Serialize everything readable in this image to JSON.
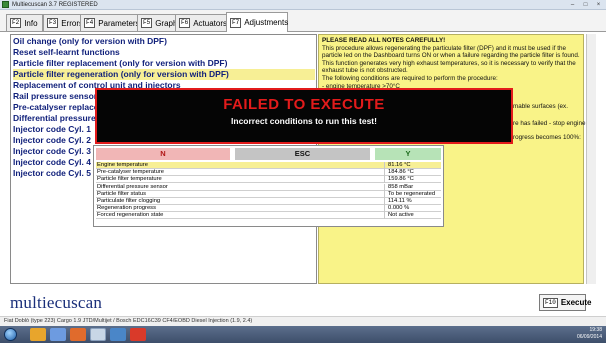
{
  "window": {
    "title": "Multiecuscan 3.7 REGISTERED",
    "buttons": [
      "–",
      "□",
      "×"
    ]
  },
  "tabs": [
    {
      "fkey": "F2",
      "label": "Info"
    },
    {
      "fkey": "F3",
      "label": "Errors"
    },
    {
      "fkey": "F4",
      "label": "Parameters"
    },
    {
      "fkey": "F5",
      "label": "Graph"
    },
    {
      "fkey": "F6",
      "label": "Actuators"
    },
    {
      "fkey": "F7",
      "label": "Adjustments"
    }
  ],
  "active_tab": "Adjustments",
  "procedures": [
    "Oil change (only for version with DPF)",
    "Reset self-learnt functions",
    "Particle filter replacement (only for version with DPF)",
    "Particle filter regeneration (only for version with DPF)",
    "Replacement of control unit and injectors",
    "Rail pressure sensor",
    "Pre-catalyser replace",
    "Differential pressure",
    "Injector code Cyl. 1",
    "Injector code Cyl. 2",
    "Injector code Cyl. 3",
    "Injector code Cyl. 4",
    "Injector code Cyl. 5"
  ],
  "selected_procedure": "Particle filter regeneration (only for version with DPF)",
  "notes": {
    "lines": [
      "PLEASE READ ALL NOTES CAREFULLY!",
      "This procedure allows regenerating the particulate filter (DPF) and it must be used if the",
      "particle led on the Dashboard turns ON or when a failure regarding the particle filter is found.",
      "This function generates very high exhaust temperatures, so it is necessary to verify that the",
      "exhaust tube is not obstructed.",
      "The following conditions are required to perform the procedure:",
      "- engine temperature >70°C"
    ],
    "partial_texts": [
      "mable surfaces (ex.",
      "re has failed - stop engine",
      "rogress becomes 100%:"
    ]
  },
  "failed_dialog": {
    "title": "FAILED TO EXECUTE",
    "message": "Incorrect conditions to run this test!"
  },
  "nty_buttons": {
    "n": "N",
    "esc": "ESC",
    "y": "Y"
  },
  "parameters": [
    {
      "name": "Engine temperature",
      "value": "81.16 °C"
    },
    {
      "name": "Pre-catalyser temperature",
      "value": "184.86 °C"
    },
    {
      "name": "Particle filter temperature",
      "value": "159.86 °C"
    },
    {
      "name": "Differential pressure sensor",
      "value": "858 mBar"
    },
    {
      "name": "Particle filter status",
      "value": "To be regenerated"
    },
    {
      "name": "Particulate filter clogging",
      "value": "114.11 %"
    },
    {
      "name": "Regeneration progress",
      "value": "0.000 %"
    },
    {
      "name": "Forced regeneration state",
      "value": "Not active"
    }
  ],
  "brand": "multiecuscan",
  "execute": {
    "fkey": "F10",
    "label": "Execute"
  },
  "status": "Fiat Doblò (type 223) Cargo 1.9 JTD/Multijet / Bosch EDC16C39 CF4/EOBD Diesel Injection (1.9, 2.4)",
  "tray": {
    "time": "19:38",
    "date": "06/09/2014"
  },
  "colors": {
    "list_text": "#0f1f7a",
    "selection": "#f7ef95",
    "notes_bg": "#f9f388",
    "fail_red": "#e21b1b",
    "n_button": "#f1b6b6",
    "esc_button": "#c4c4c4",
    "y_button": "#b7e3b7"
  }
}
